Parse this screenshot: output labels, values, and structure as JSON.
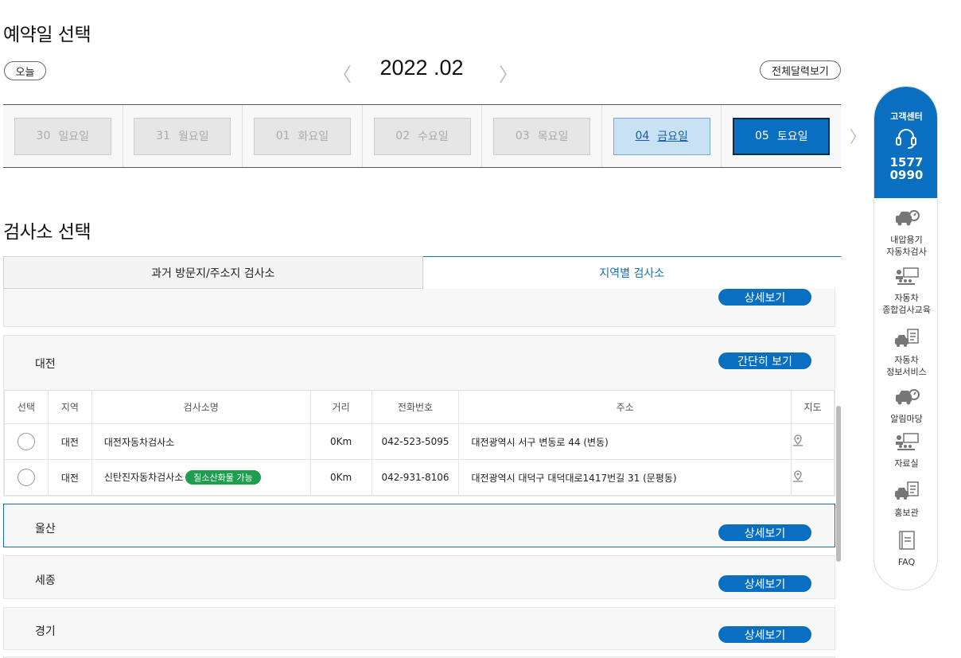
{
  "date_section": {
    "title": "예약일 선택",
    "today_btn": "오늘",
    "month": "2022 .02",
    "prev": "〈",
    "next": "〉",
    "calendar_btn": "전체달력보기",
    "more": "〉"
  },
  "days": [
    {
      "num": "30",
      "dow": "일요일",
      "state": "disabled"
    },
    {
      "num": "31",
      "dow": "월요일",
      "state": "disabled"
    },
    {
      "num": "01",
      "dow": "화요일",
      "state": "disabled"
    },
    {
      "num": "02",
      "dow": "수요일",
      "state": "disabled"
    },
    {
      "num": "03",
      "dow": "목요일",
      "state": "disabled"
    },
    {
      "num": "04",
      "dow": "금요일",
      "state": "available"
    },
    {
      "num": "05",
      "dow": "토요일",
      "state": "selected"
    }
  ],
  "center_section": {
    "title": "검사소 선택",
    "tabs": [
      "과거 방문지/주소지 검사소",
      "지역별 검사소"
    ]
  },
  "regions": {
    "prev_btn": "상세보기",
    "daejeon": {
      "name": "대전",
      "btn": "간단히 보기"
    },
    "ulsan": {
      "name": "울산",
      "btn": "상세보기"
    },
    "sejong": {
      "name": "세종",
      "btn": "상세보기"
    },
    "gyeonggi": {
      "name": "경기",
      "btn": "상세보기"
    }
  },
  "table": {
    "headers": [
      "선택",
      "지역",
      "검사소명",
      "거리",
      "전화번호",
      "주소",
      "지도"
    ],
    "rows": [
      {
        "region": "대전",
        "name": "대전자동차검사소",
        "badge": "",
        "distance": "0Km",
        "phone": "042-523-5095",
        "address": "대전광역시 서구 변동로 44 (변동)"
      },
      {
        "region": "대전",
        "name": "신탄진자동차검사소",
        "badge": "질소산화물 가능",
        "distance": "0Km",
        "phone": "042-931-8106",
        "address": "대전광역시 대덕구 대덕대로1417번길 31 (문평동)"
      }
    ]
  },
  "sidebar": {
    "center_label": "고객센터",
    "phone_1": "1577",
    "phone_2": "0990",
    "items": [
      {
        "l1": "내압용기",
        "l2": "자동차검사",
        "icon": "car-gauge-icon"
      },
      {
        "l1": "자동차",
        "l2": "종합검사교육",
        "icon": "classroom-icon"
      },
      {
        "l1": "자동차",
        "l2": "정보서비스",
        "icon": "car-doc-icon"
      },
      {
        "l1": "알림마당",
        "l2": "",
        "icon": "car-gauge-icon"
      },
      {
        "l1": "자료실",
        "l2": "",
        "icon": "classroom-icon"
      },
      {
        "l1": "홍보관",
        "l2": "",
        "icon": "car-doc-icon"
      },
      {
        "l1": "FAQ",
        "l2": "",
        "icon": "faq-icon"
      }
    ]
  },
  "colors": {
    "accent": "#0a6fc0",
    "green": "#1e9e4e"
  }
}
